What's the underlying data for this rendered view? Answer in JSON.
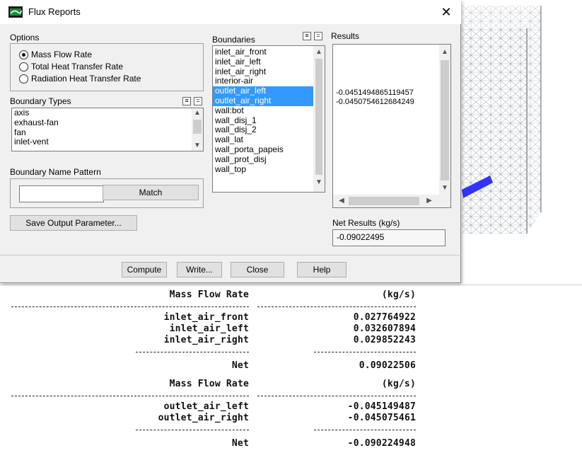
{
  "dialog": {
    "title": "Flux Reports",
    "options": {
      "label": "Options",
      "radios": [
        {
          "label": "Mass Flow Rate",
          "selected": true
        },
        {
          "label": "Total Heat Transfer Rate",
          "selected": false
        },
        {
          "label": "Radiation Heat Transfer Rate",
          "selected": false
        }
      ]
    },
    "boundary_types": {
      "label": "Boundary Types",
      "items": [
        "axis",
        "exhaust-fan",
        "fan",
        "inlet-vent"
      ]
    },
    "boundary_name_pattern": {
      "label": "Boundary Name Pattern",
      "value": "",
      "match_label": "Match"
    },
    "save_output_label": "Save Output Parameter...",
    "boundaries": {
      "label": "Boundaries",
      "items": [
        {
          "label": "inlet_air_front",
          "selected": false
        },
        {
          "label": "inlet_air_left",
          "selected": false
        },
        {
          "label": "inlet_air_right",
          "selected": false
        },
        {
          "label": "interior-air",
          "selected": false
        },
        {
          "label": "outlet_air_left",
          "selected": true
        },
        {
          "label": "outlet_air_right",
          "selected": true
        },
        {
          "label": "wall:bot",
          "selected": false
        },
        {
          "label": "wall_disj_1",
          "selected": false
        },
        {
          "label": "wall_disj_2",
          "selected": false
        },
        {
          "label": "wall_lat",
          "selected": false
        },
        {
          "label": "wall_porta_papeis",
          "selected": false
        },
        {
          "label": "wall_prot_disj",
          "selected": false
        },
        {
          "label": "wall_top",
          "selected": false
        }
      ]
    },
    "results": {
      "label": "Results",
      "lines": [
        "-0.0451494865119457",
        "-0.0450754612684249"
      ],
      "net_label": "Net Results (kg/s)",
      "net_value": "-0.09022495"
    },
    "buttons": {
      "compute": "Compute",
      "write": "Write...",
      "close": "Close",
      "help": "Help"
    }
  },
  "console": {
    "blocks": [
      {
        "header_name": "Mass Flow Rate",
        "header_unit": "(kg/s)",
        "rows": [
          {
            "name": "inlet_air_front",
            "value": "0.027764922"
          },
          {
            "name": "inlet_air_left",
            "value": "0.032607894"
          },
          {
            "name": "inlet_air_right",
            "value": "0.029852243"
          }
        ],
        "net_label": "Net",
        "net_value": "0.09022506"
      },
      {
        "header_name": "Mass Flow Rate",
        "header_unit": "(kg/s)",
        "rows": [
          {
            "name": "outlet_air_left",
            "value": "-0.045149487"
          },
          {
            "name": "outlet_air_right",
            "value": "-0.045075461"
          }
        ],
        "net_label": "Net",
        "net_value": "-0.090224948"
      }
    ]
  },
  "colors": {
    "selection": "#3399ff",
    "mesh_line": "#9aa3ad",
    "mesh_highlight": "#3333ff"
  }
}
